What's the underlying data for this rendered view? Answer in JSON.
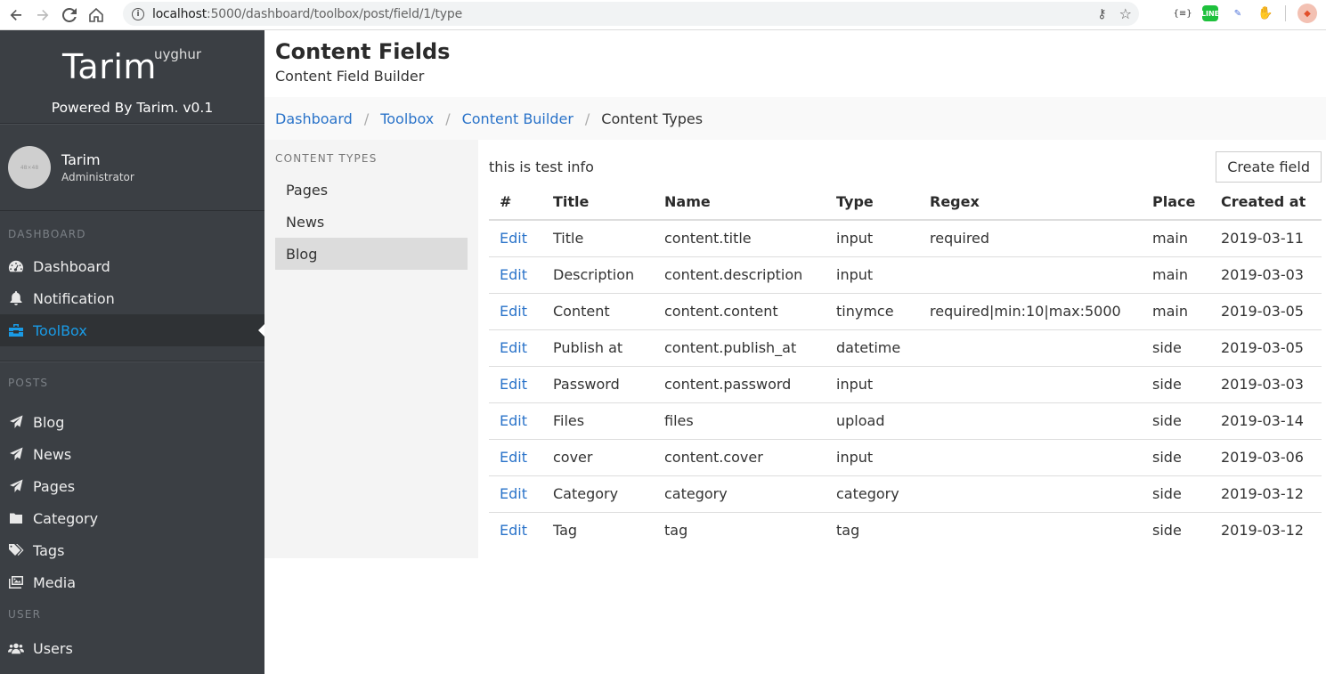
{
  "browser": {
    "url_host": "localhost",
    "url_path": ":5000/dashboard/toolbox/post/field/1/type"
  },
  "sidebar": {
    "brand": "Tarim",
    "brand_sup": "uyghur",
    "powered_by": "Powered By Tarim. v0.1",
    "user": {
      "name": "Tarim",
      "role": "Administrator",
      "avatar_placeholder": "48×48"
    },
    "sections": [
      {
        "label": "DASHBOARD",
        "items": [
          {
            "label": "Dashboard",
            "icon": "tachometer-icon"
          },
          {
            "label": "Notification",
            "icon": "bell-icon"
          },
          {
            "label": "ToolBox",
            "icon": "toolbox-icon",
            "active": true
          }
        ]
      },
      {
        "label": "POSTS",
        "items": [
          {
            "label": "Blog",
            "icon": "paper-plane-icon"
          },
          {
            "label": "News",
            "icon": "paper-plane-icon"
          },
          {
            "label": "Pages",
            "icon": "paper-plane-icon"
          },
          {
            "label": "Category",
            "icon": "folder-icon"
          },
          {
            "label": "Tags",
            "icon": "tags-icon"
          },
          {
            "label": "Media",
            "icon": "images-icon"
          }
        ]
      },
      {
        "label": "USER",
        "items": [
          {
            "label": "Users",
            "icon": "users-icon"
          }
        ]
      }
    ],
    "active_color": "#1a9be6"
  },
  "header": {
    "title": "Content Fields",
    "subtitle": "Content Field Builder"
  },
  "breadcrumb": {
    "items": [
      "Dashboard",
      "Toolbox",
      "Content Builder"
    ],
    "current": "Content Types"
  },
  "content_types": {
    "label": "CONTENT TYPES",
    "items": [
      "Pages",
      "News",
      "Blog"
    ],
    "active": "Blog"
  },
  "fields": {
    "info": "this is test info",
    "create_button": "Create field",
    "columns": [
      "#",
      "Title",
      "Name",
      "Type",
      "Regex",
      "Place",
      "Created at"
    ],
    "edit_label": "Edit",
    "rows": [
      {
        "title": "Title",
        "name": "content.title",
        "type": "input",
        "regex": "required",
        "place": "main",
        "created_at": "2019-03-11"
      },
      {
        "title": "Description",
        "name": "content.description",
        "type": "input",
        "regex": "",
        "place": "main",
        "created_at": "2019-03-03"
      },
      {
        "title": "Content",
        "name": "content.content",
        "type": "tinymce",
        "regex": "required|min:10|max:5000",
        "place": "main",
        "created_at": "2019-03-05"
      },
      {
        "title": "Publish at",
        "name": "content.publish_at",
        "type": "datetime",
        "regex": "",
        "place": "side",
        "created_at": "2019-03-05"
      },
      {
        "title": "Password",
        "name": "content.password",
        "type": "input",
        "regex": "",
        "place": "side",
        "created_at": "2019-03-03"
      },
      {
        "title": "Files",
        "name": "files",
        "type": "upload",
        "regex": "",
        "place": "side",
        "created_at": "2019-03-14"
      },
      {
        "title": "cover",
        "name": "content.cover",
        "type": "input",
        "regex": "",
        "place": "side",
        "created_at": "2019-03-06"
      },
      {
        "title": "Category",
        "name": "category",
        "type": "category",
        "regex": "",
        "place": "side",
        "created_at": "2019-03-12"
      },
      {
        "title": "Tag",
        "name": "tag",
        "type": "tag",
        "regex": "",
        "place": "side",
        "created_at": "2019-03-12"
      }
    ]
  }
}
